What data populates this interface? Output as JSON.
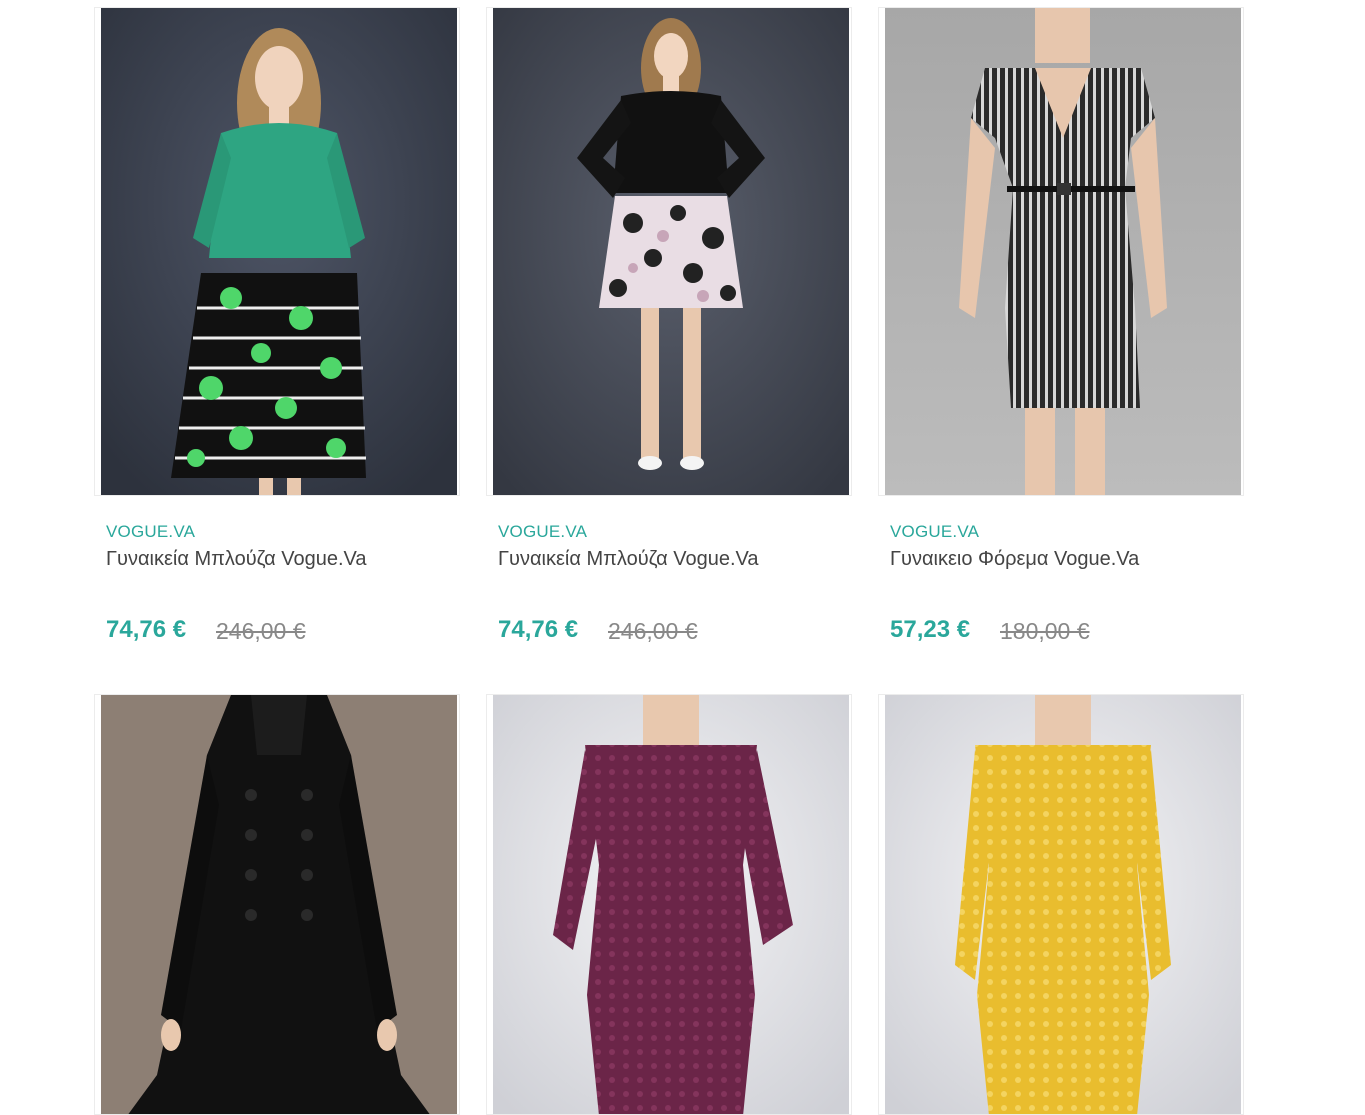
{
  "products": [
    {
      "brand": "VOGUE.VA",
      "name": "Γυναικεία Μπλούζα Vogue.Va",
      "price": "74,76 €",
      "old_price": "246,00 €"
    },
    {
      "brand": "VOGUE.VA",
      "name": "Γυναικεία Μπλούζα Vogue.Va",
      "price": "74,76 €",
      "old_price": "246,00 €"
    },
    {
      "brand": "VOGUE.VA",
      "name": "Γυναικειο Φόρεμα Vogue.Va",
      "price": "57,23 €",
      "old_price": "180,00 €"
    },
    {
      "brand": "",
      "name": "",
      "price": "",
      "old_price": ""
    },
    {
      "brand": "",
      "name": "",
      "price": "",
      "old_price": ""
    },
    {
      "brand": "",
      "name": "",
      "price": "",
      "old_price": ""
    }
  ],
  "colors": {
    "accent": "#2aa79b",
    "text": "#444444",
    "muted": "#888888"
  }
}
